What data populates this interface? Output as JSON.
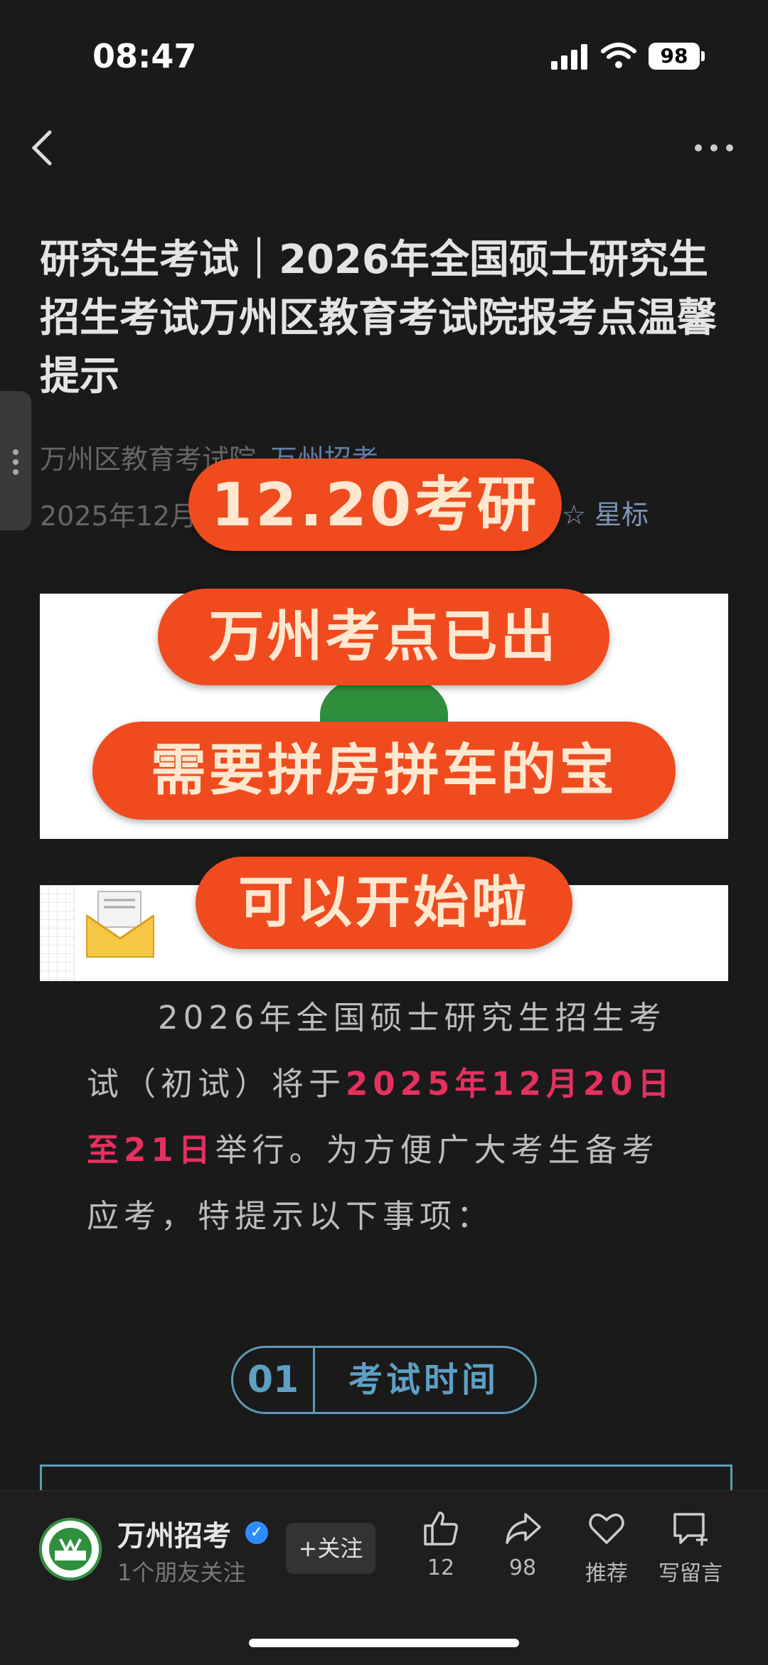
{
  "status_bar": {
    "time": "08:47",
    "battery": "98"
  },
  "article": {
    "title": "研究生考试｜2026年全国硕士研究生招生考试万州区教育考试院报考点温馨提示",
    "author": "万州区教育考试院",
    "account": "万州招考",
    "date": "2025年12月",
    "star_label": "☆ 星标"
  },
  "overlay_captions": [
    "12.20考研",
    "万州考点已出",
    "需要拼房拼车的宝",
    "可以开始啦"
  ],
  "paragraph": {
    "part1": "2026年全国硕士研究生招生考试（初试）将于",
    "highlight": "2025年12月20日至21日",
    "part2": "举行。为方便广大考生备考应考，特提示以下事项："
  },
  "section": {
    "number": "01",
    "label": "考试时间"
  },
  "bottom_bar": {
    "account_name": "万州招考",
    "friends": "1个朋友关注",
    "follow": "+关注",
    "like_count": "12",
    "share_count": "98",
    "recommend": "推荐",
    "comment": "写留言"
  },
  "colors": {
    "accent_red": "#e6305f",
    "pill": "#ef4b1f",
    "section_blue": "#5ea0c4"
  }
}
